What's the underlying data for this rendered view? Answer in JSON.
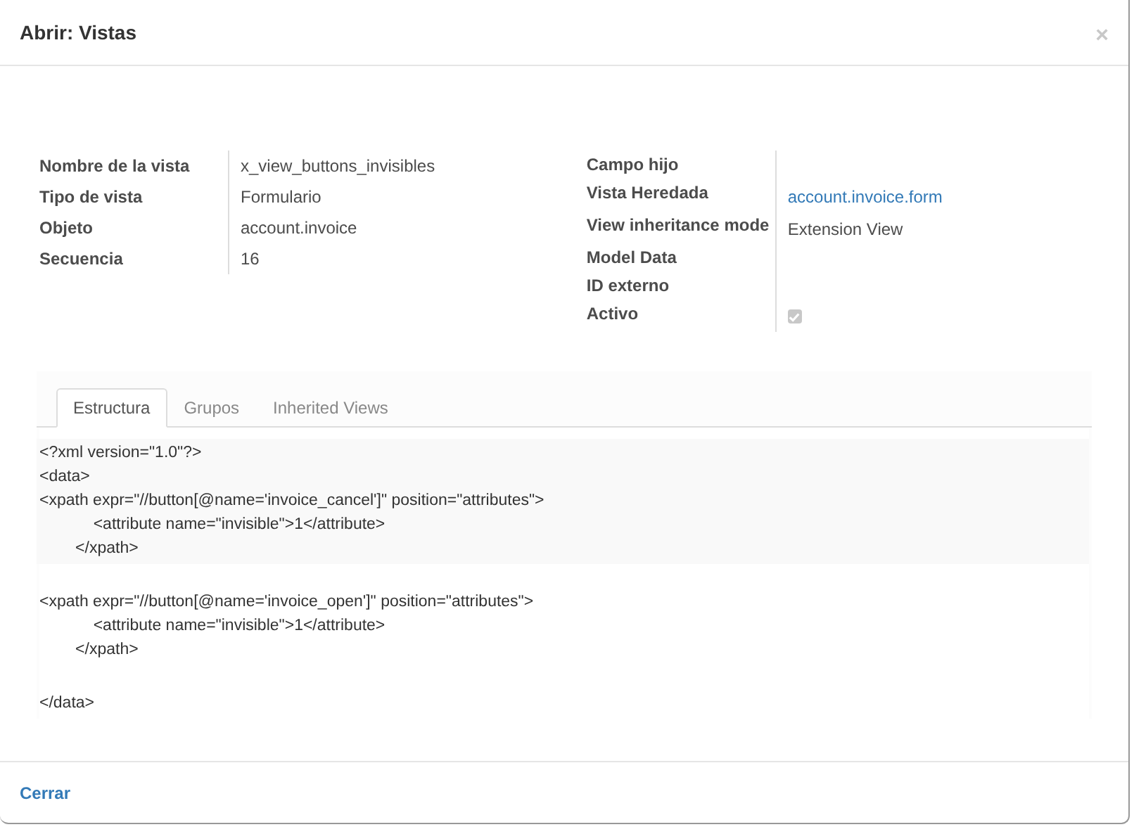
{
  "dialog": {
    "title": "Abrir: Vistas",
    "close_icon": "×"
  },
  "left_fields": [
    {
      "label": "Nombre de la vista",
      "kind": "text",
      "value": "x_view_buttons_invisibles"
    },
    {
      "label": "Tipo de vista",
      "kind": "text",
      "value": "Formulario"
    },
    {
      "label": "Objeto",
      "kind": "text",
      "value": "account.invoice"
    },
    {
      "label": "Secuencia",
      "kind": "text",
      "value": "16"
    }
  ],
  "right_fields": [
    {
      "label": "Campo hijo",
      "kind": "empty"
    },
    {
      "label": "Vista Heredada",
      "kind": "link",
      "value": "account.invoice.form"
    },
    {
      "label": "View inheritance mode",
      "kind": "text",
      "value": "Extension View"
    },
    {
      "label": "Model Data",
      "kind": "empty"
    },
    {
      "label": "ID externo",
      "kind": "empty"
    },
    {
      "label": "Activo",
      "kind": "checkbox",
      "checked": true,
      "disabled": true
    }
  ],
  "tabs": [
    {
      "label": "Estructura",
      "selected": true
    },
    {
      "label": "Grupos",
      "selected": false
    },
    {
      "label": "Inherited Views",
      "selected": false
    }
  ],
  "code_blocks": [
    {
      "highlighted": true,
      "lines": [
        "<?xml version=\"1.0\"?>",
        "<data>",
        "<xpath expr=\"//button[@name='invoice_cancel']\" position=\"attributes\">",
        "            <attribute name=\"invisible\">1</attribute>",
        "        </xpath>"
      ]
    },
    {
      "highlighted": false,
      "lines": [
        "<xpath expr=\"//button[@name='invoice_open']\" position=\"attributes\">",
        "            <attribute name=\"invisible\">1</attribute>",
        "        </xpath>"
      ]
    },
    {
      "highlighted": false,
      "lines": [
        "</data>"
      ]
    }
  ],
  "footer": {
    "close_button": "Cerrar"
  }
}
